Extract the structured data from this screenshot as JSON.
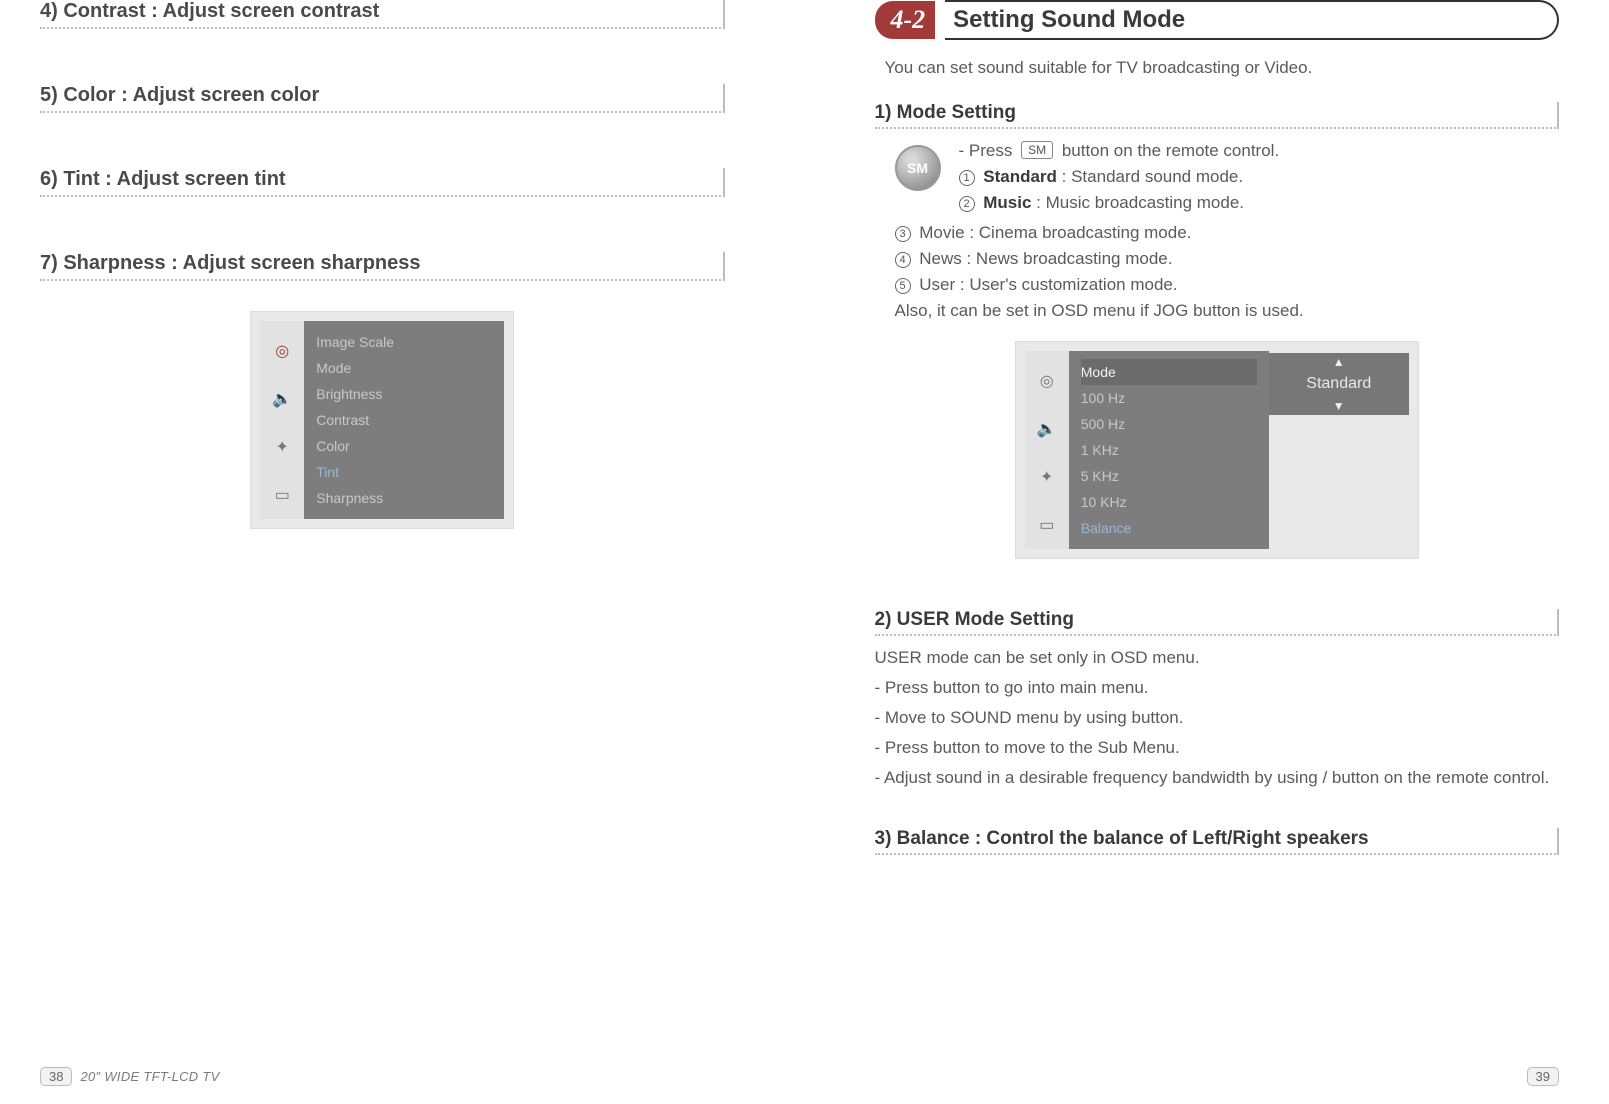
{
  "left": {
    "h4": "4) Contrast : Adjust screen contrast",
    "h5": "5) Color : Adjust screen color",
    "h6": "6) Tint : Adjust screen tint",
    "h7": "7) Sharpness : Adjust screen sharpness",
    "osd": {
      "items": [
        "Image Scale",
        "Mode",
        "Brightness",
        "Contrast",
        "Color",
        "Tint",
        "Sharpness"
      ]
    },
    "page_no": "38",
    "model": "20\" WIDE TFT-LCD TV"
  },
  "right": {
    "chapter_no": "4-2",
    "chapter_title": "Setting Sound Mode",
    "intro": "You can set sound suitable for TV broadcasting or Video.",
    "s1_title": "1) Mode Setting",
    "sm_label": "SM",
    "press_prefix": "- Press",
    "press_btn": "SM",
    "press_suffix": "button on the remote control.",
    "modes": [
      {
        "n": "1",
        "name": "Standard",
        "desc": "Standard sound mode."
      },
      {
        "n": "2",
        "name": "Music",
        "desc": "Music broadcasting mode."
      },
      {
        "n": "3",
        "name": "Movie",
        "desc": "Cinema broadcasting mode."
      },
      {
        "n": "4",
        "name": "News",
        "desc": "News broadcasting mode."
      },
      {
        "n": "5",
        "name": "User",
        "desc": "User's customization mode."
      }
    ],
    "also_line": "Also, it can be set in OSD menu if JOG button is used.",
    "osd": {
      "items": [
        "Mode",
        "100 Hz",
        "500 Hz",
        "1 KHz",
        "5 KHz",
        "10 KHz",
        "Balance"
      ],
      "value": "Standard",
      "arrow_up": "▲",
      "arrow_down": "▼"
    },
    "s2_title": "2) USER Mode Setting",
    "s2_lines": [
      "USER mode can be set only in OSD menu.",
      "- Press button to go into main menu.",
      "- Move to SOUND menu by using button.",
      "- Press button to move to the Sub Menu.",
      "- Adjust sound in a desirable frequency bandwidth by using / button on the remote control."
    ],
    "s3_title": "3) Balance : Control the balance of Left/Right speakers",
    "page_no": "39"
  }
}
